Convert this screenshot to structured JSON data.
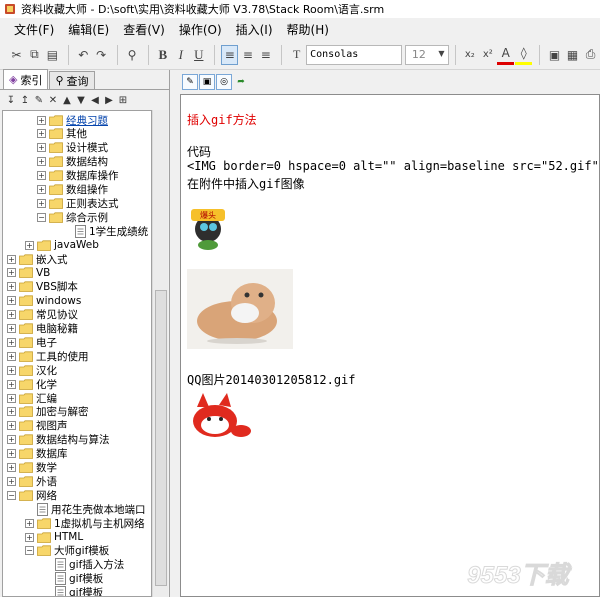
{
  "window": {
    "title": "资料收藏大师 - D:\\soft\\实用\\资料收藏大师 V3.78\\Stack Room\\语言.srm"
  },
  "menu": [
    "文件(F)",
    "编辑(E)",
    "查看(V)",
    "操作(O)",
    "插入(I)",
    "帮助(H)"
  ],
  "toolbar": {
    "font": "Consolas",
    "size": "12"
  },
  "left": {
    "tabs": [
      "索引",
      "查询"
    ],
    "tree": [
      {
        "label": "经典习题",
        "expander": "+",
        "icon": "folder",
        "selected": true
      },
      {
        "label": "其他",
        "expander": "+",
        "icon": "folder"
      },
      {
        "label": "设计模式",
        "expander": "+",
        "icon": "folder"
      },
      {
        "label": "数据结构",
        "expander": "+",
        "icon": "folder"
      },
      {
        "label": "数据库操作",
        "expander": "+",
        "icon": "folder"
      },
      {
        "label": "数组操作",
        "expander": "+",
        "icon": "folder"
      },
      {
        "label": "正则表达式",
        "expander": "+",
        "icon": "folder"
      },
      {
        "label": "综合示例",
        "expander": "-",
        "icon": "folder"
      },
      {
        "label": "1学生成绩统",
        "expander": "",
        "icon": "doc"
      },
      {
        "label": "javaWeb",
        "expander": "+",
        "icon": "folder"
      },
      {
        "label": "嵌入式",
        "expander": "+",
        "icon": "folder"
      },
      {
        "label": "VB",
        "expander": "+",
        "icon": "folder"
      },
      {
        "label": "VBS脚本",
        "expander": "+",
        "icon": "folder"
      },
      {
        "label": "windows",
        "expander": "+",
        "icon": "folder"
      },
      {
        "label": "常见协议",
        "expander": "+",
        "icon": "folder"
      },
      {
        "label": "电脑秘籍",
        "expander": "+",
        "icon": "folder"
      },
      {
        "label": "电子",
        "expander": "+",
        "icon": "folder"
      },
      {
        "label": "工具的使用",
        "expander": "+",
        "icon": "folder"
      },
      {
        "label": "汉化",
        "expander": "+",
        "icon": "folder"
      },
      {
        "label": "化学",
        "expander": "+",
        "icon": "folder"
      },
      {
        "label": "汇编",
        "expander": "+",
        "icon": "folder"
      },
      {
        "label": "加密与解密",
        "expander": "+",
        "icon": "folder"
      },
      {
        "label": "视图声",
        "expander": "+",
        "icon": "folder"
      },
      {
        "label": "数据结构与算法",
        "expander": "+",
        "icon": "folder"
      },
      {
        "label": "数据库",
        "expander": "+",
        "icon": "folder"
      },
      {
        "label": "数学",
        "expander": "+",
        "icon": "folder"
      },
      {
        "label": "外语",
        "expander": "+",
        "icon": "folder"
      },
      {
        "label": "网络",
        "expander": "-",
        "icon": "folder"
      },
      {
        "label": "用花生壳做本地端口",
        "expander": "",
        "icon": "doc"
      },
      {
        "label": "1虚拟机与主机网络",
        "expander": "+",
        "icon": "folder"
      },
      {
        "label": "HTML",
        "expander": "+",
        "icon": "folder"
      },
      {
        "label": "大师gif模板",
        "expander": "-",
        "icon": "folder"
      },
      {
        "label": "gif插入方法",
        "expander": "",
        "icon": "doc"
      },
      {
        "label": "gif模板",
        "expander": "",
        "icon": "doc"
      },
      {
        "label": "gif模板",
        "expander": "",
        "icon": "doc"
      }
    ]
  },
  "doc": {
    "title": "插入gif方法",
    "heading": "代码",
    "code": "<IMG border=0 hspace=0 alt=\"\" align=baseline src=\"52.gif\">",
    "desc": "在附件中插入gif图像",
    "caption": "QQ图片20140301205812.gif",
    "bomb_text": "爆头"
  },
  "watermark": "9553下载",
  "colors": {
    "red_text": "#e00000",
    "selected_link": "#0645ad"
  }
}
